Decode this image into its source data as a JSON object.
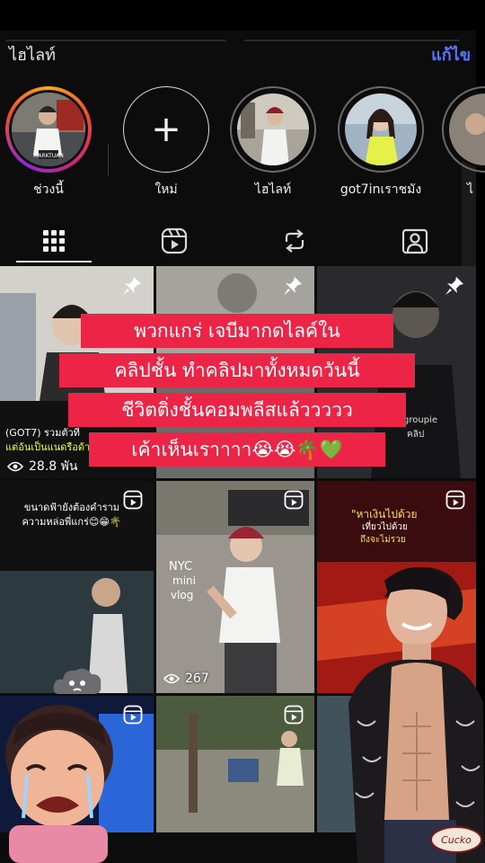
{
  "highlights": {
    "title": "ไฮไลท์",
    "edit_label": "แก้ไข",
    "items": [
      {
        "label": "ช่วงนี้",
        "badge_text": "MARKTUAN"
      },
      {
        "label": "ใหม่"
      },
      {
        "label": "ไฮไลท์"
      },
      {
        "label": "got7inเราชมัง"
      },
      {
        "label": "ไ"
      }
    ]
  },
  "tabs": [
    {
      "name": "grid",
      "icon": "grid-icon",
      "active": true
    },
    {
      "name": "reels",
      "icon": "reels-icon"
    },
    {
      "name": "reposts",
      "icon": "repost-icon"
    },
    {
      "name": "tagged",
      "icon": "tagged-icon"
    }
  ],
  "posts": [
    {
      "pinned": true,
      "caption_lines": [
        "(GOT7) รวมตัวที่",
        "แต่อ้นเป็นแนดรือด้า"
      ],
      "views": "28.8 พัน"
    },
    {
      "pinned": true
    },
    {
      "pinned": true,
      "caption": "groupie",
      "caption2": "คลิป"
    },
    {
      "reel": true,
      "caption_lines": [
        "ขนาดฟ้ายังต้องคำราม",
        "ความหล่อพี่แกร่😊😁🌴"
      ]
    },
    {
      "reel": true,
      "caption_lines": [
        "NYC",
        "mini",
        "vlog"
      ],
      "views": "267"
    },
    {
      "reel": true,
      "caption_lines": [
        "\"หาเงินไปด้วย",
        "เที่ยวไปด้วย",
        "ถึงจะไม่รวย"
      ]
    },
    {
      "reel": true
    },
    {
      "reel": true
    },
    {
      "reel": true
    }
  ],
  "overlay_text": [
    "พวกแกร่ เจบีมากดไลค์ใน",
    "คลิปชั้น ทำคลิปมาทั้งหมดวันนี้",
    "ชีวิตติ่งชั้นคอมพลีสแล้ววววว",
    "เค้าเห็นเราาาา😭😭🌴💚"
  ],
  "sticker_text": "Cucko",
  "colors": {
    "accent_link": "#5a74ff",
    "overlay_red": "#ec2546",
    "background": "#0c0c0d"
  }
}
